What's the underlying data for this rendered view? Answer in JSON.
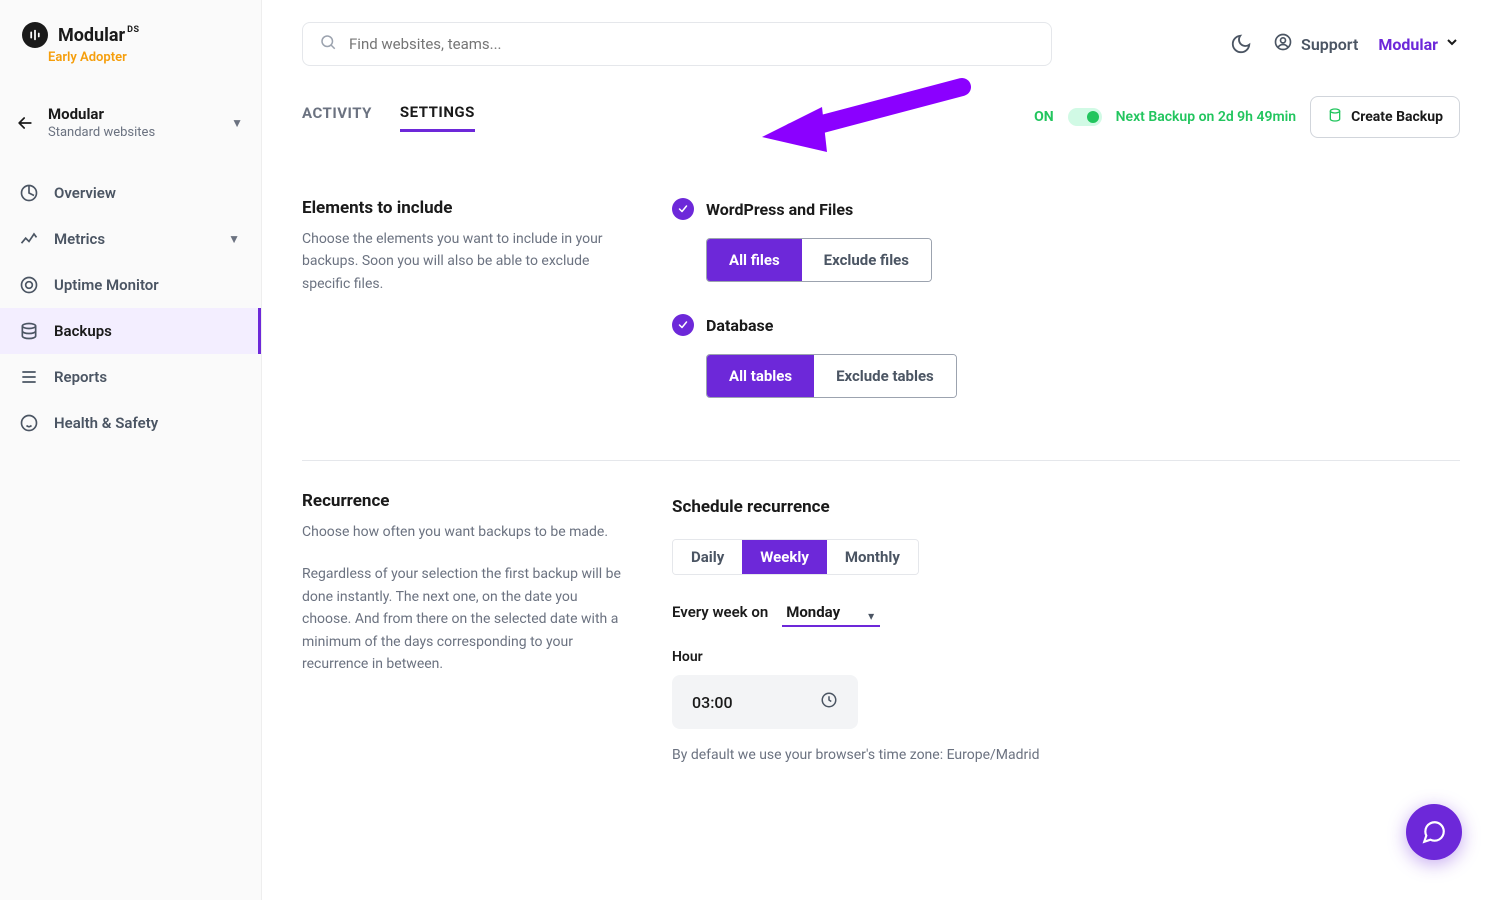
{
  "brand": {
    "name": "Modular",
    "ds": "DS",
    "tagline": "Early Adopter"
  },
  "breadcrumb": {
    "title": "Modular",
    "subtitle": "Standard websites"
  },
  "nav": {
    "overview": "Overview",
    "metrics": "Metrics",
    "uptime": "Uptime Monitor",
    "backups": "Backups",
    "reports": "Reports",
    "health": "Health & Safety"
  },
  "search": {
    "placeholder": "Find websites, teams..."
  },
  "topbar": {
    "support": "Support",
    "account": "Modular"
  },
  "tabs": {
    "activity": "ACTIVITY",
    "settings": "SETTINGS"
  },
  "status": {
    "on": "ON",
    "next": "Next Backup on 2d 9h 49min",
    "create": "Create Backup"
  },
  "elements": {
    "title": "Elements to include",
    "desc": "Choose the elements you want to include in your backups. Soon you will also be able to exclude specific files.",
    "wp": "WordPress and Files",
    "all_files": "All files",
    "exclude_files": "Exclude files",
    "db": "Database",
    "all_tables": "All tables",
    "exclude_tables": "Exclude tables"
  },
  "recurrence": {
    "title": "Recurrence",
    "desc1": "Choose how often you want backups to be made.",
    "desc2": "Regardless of your selection the first backup will be done instantly. The next one, on the date you choose. And from there on the selected date with a minimum of the days corresponding to your recurrence in between.",
    "schedule_title": "Schedule recurrence",
    "daily": "Daily",
    "weekly": "Weekly",
    "monthly": "Monthly",
    "every_week_on": "Every week on",
    "day": "Monday",
    "hour_label": "Hour",
    "hour": "03:00",
    "tz_note": "By default we use your browser's time zone: Europe/Madrid"
  }
}
